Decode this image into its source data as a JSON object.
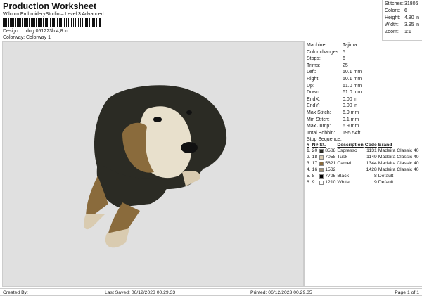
{
  "header": {
    "title": "Production Worksheet",
    "subtitle": "Wilcom EmbroideryStudio – Level 3 Advanced",
    "design_label": "Design:",
    "design_value": "dog 051223b 4,8 in",
    "colorway_label": "Colorway:",
    "colorway_value": "Colorway 1"
  },
  "stats": [
    {
      "label": "Stitches:",
      "value": "31806"
    },
    {
      "label": "Colors:",
      "value": "6"
    },
    {
      "label": "Height:",
      "value": "4.80 in"
    },
    {
      "label": "Width:",
      "value": "3.95 in"
    },
    {
      "label": "Zoom:",
      "value": "1:1"
    }
  ],
  "info": [
    {
      "label": "Machine:",
      "value": "Tajima"
    },
    {
      "label": "Color changes:",
      "value": "5"
    },
    {
      "label": "Stops:",
      "value": "6"
    },
    {
      "label": "Trims:",
      "value": "25"
    },
    {
      "label": "Left:",
      "value": "50.1 mm"
    },
    {
      "label": "Right:",
      "value": "50.1 mm"
    },
    {
      "label": "Up:",
      "value": "61.0 mm"
    },
    {
      "label": "Down:",
      "value": "61.0 mm"
    },
    {
      "label": "EndX:",
      "value": "0.00 in"
    },
    {
      "label": "EndY:",
      "value": "0.00 in"
    },
    {
      "label": "Max Stitch:",
      "value": "6.9 mm"
    },
    {
      "label": "Min Stitch:",
      "value": "0.1 mm"
    },
    {
      "label": "Max Jump:",
      "value": "6.9 mm"
    },
    {
      "label": "Total Bobbin:",
      "value": "195.54ft"
    }
  ],
  "stop_sequence": {
    "title": "Stop Sequence:",
    "headers": [
      "#",
      "N#",
      "St.",
      "Description",
      "Code",
      "Brand"
    ],
    "rows": [
      {
        "n": "1.",
        "needle": "20",
        "color": "#2b2b24",
        "st": "8588",
        "desc": "Espresso",
        "code": "1131",
        "brand": "Madeira Classic 40"
      },
      {
        "n": "2.",
        "needle": "18",
        "color": "#d9cbb0",
        "st": "7058",
        "desc": "Tusk",
        "code": "1149",
        "brand": "Madeira Classic 40"
      },
      {
        "n": "3.",
        "needle": "17",
        "color": "#8a6b3c",
        "st": "5621",
        "desc": "Camel",
        "code": "1344",
        "brand": "Madeira Classic 40"
      },
      {
        "n": "4.",
        "needle": "16",
        "color": "#a39274",
        "st": "1532",
        "desc": "",
        "code": "1428",
        "brand": "Madeira Classic 40"
      },
      {
        "n": "5.",
        "needle": "8",
        "color": "#000000",
        "st": "7795",
        "desc": "Black",
        "code": "8",
        "brand": "Default"
      },
      {
        "n": "6.",
        "needle": "9",
        "color": "#ffffff",
        "st": "1210",
        "desc": "White",
        "code": "9",
        "brand": "Default"
      }
    ]
  },
  "footer": {
    "created": "Created By:",
    "saved": "Last Saved: 06/12/2023 00.29.33",
    "printed": "Printed: 06/12/2023 00.29.35",
    "page": "Page 1 of 1"
  }
}
